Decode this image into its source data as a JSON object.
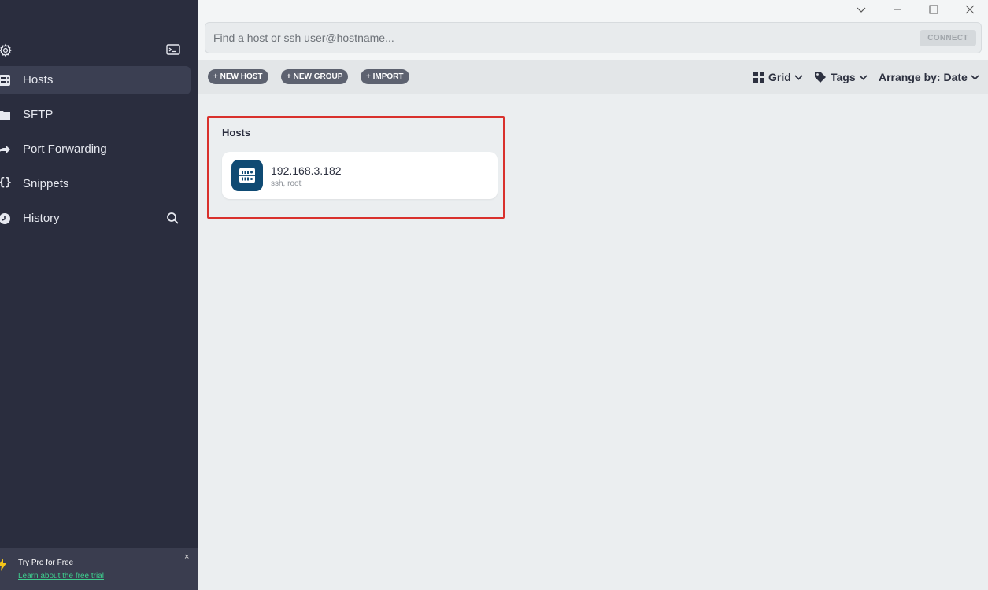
{
  "sidebar": {
    "items": [
      {
        "label": "Hosts",
        "icon": "hosts-icon"
      },
      {
        "label": "SFTP",
        "icon": "folder-icon"
      },
      {
        "label": "Port Forwarding",
        "icon": "port-forwarding-icon"
      },
      {
        "label": "Snippets",
        "icon": "braces-icon"
      },
      {
        "label": "History",
        "icon": "clock-icon"
      }
    ],
    "promo": {
      "title": "Try Pro for Free",
      "link": "Learn about the free trial",
      "close": "×"
    }
  },
  "search": {
    "placeholder": "Find a host or ssh user@hostname...",
    "connect_label": "CONNECT"
  },
  "toolbar": {
    "new_host": "+ NEW HOST",
    "new_group": "+ NEW GROUP",
    "import": "+ IMPORT",
    "view_label": "Grid",
    "tags_label": "Tags",
    "arrange_label": "Arrange by: Date"
  },
  "main": {
    "group_title": "Hosts",
    "hosts": [
      {
        "name": "192.168.3.182",
        "details": "ssh, root"
      }
    ]
  },
  "colors": {
    "sidebar_bg": "#2a2d3e",
    "accent_host_icon": "#0f4a73",
    "highlight_border": "#d9302c",
    "promo_link": "#3ecf8e"
  }
}
